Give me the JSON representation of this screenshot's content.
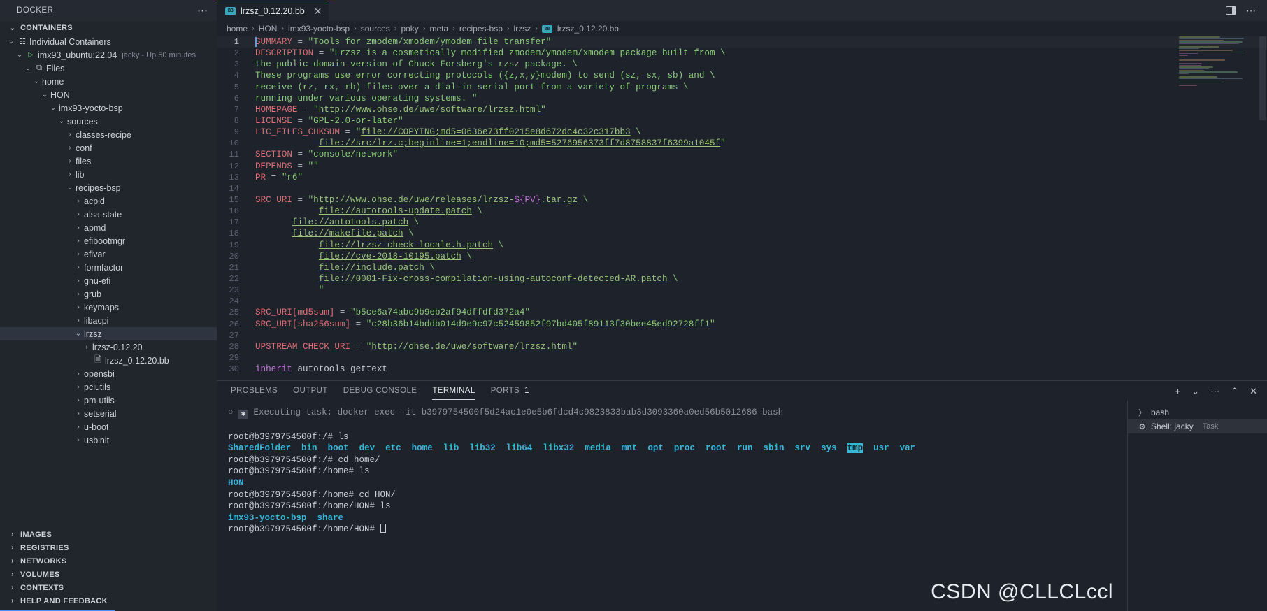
{
  "topbar": {
    "title": "DOCKER",
    "more_label": "⋯",
    "tab": {
      "label": "lrzsz_0.12.20.bb",
      "icon_text": "BB",
      "close": "✕"
    },
    "split_editor": "split-editor",
    "more_actions": "⋯"
  },
  "sidebar": {
    "sections": [
      {
        "label": "CONTAINERS",
        "expanded": true
      },
      {
        "label": "IMAGES",
        "expanded": false
      },
      {
        "label": "REGISTRIES",
        "expanded": false
      },
      {
        "label": "NETWORKS",
        "expanded": false
      },
      {
        "label": "VOLUMES",
        "expanded": false
      },
      {
        "label": "CONTEXTS",
        "expanded": false
      },
      {
        "label": "HELP AND FEEDBACK",
        "expanded": false
      }
    ],
    "tree": [
      {
        "label": "Individual Containers",
        "indent": 1,
        "twisty": "⌄",
        "icon": "containers-icon",
        "sub": ""
      },
      {
        "label": "imx93_ubuntu:22.04",
        "indent": 2,
        "twisty": "⌄",
        "icon": "play-icon",
        "sub": "jacky - Up 50 minutes"
      },
      {
        "label": "Files",
        "indent": 3,
        "twisty": "⌄",
        "icon": "files-icon",
        "sub": ""
      },
      {
        "label": "home",
        "indent": 4,
        "twisty": "⌄",
        "icon": "",
        "sub": ""
      },
      {
        "label": "HON",
        "indent": 5,
        "twisty": "⌄",
        "icon": "",
        "sub": ""
      },
      {
        "label": "imx93-yocto-bsp",
        "indent": 6,
        "twisty": "⌄",
        "icon": "",
        "sub": ""
      },
      {
        "label": "sources",
        "indent": 7,
        "twisty": "⌄",
        "icon": "",
        "sub": ""
      },
      {
        "label": "classes-recipe",
        "indent": 8,
        "twisty": "›",
        "icon": "",
        "sub": ""
      },
      {
        "label": "conf",
        "indent": 8,
        "twisty": "›",
        "icon": "",
        "sub": ""
      },
      {
        "label": "files",
        "indent": 8,
        "twisty": "›",
        "icon": "",
        "sub": ""
      },
      {
        "label": "lib",
        "indent": 8,
        "twisty": "›",
        "icon": "",
        "sub": ""
      },
      {
        "label": "recipes-bsp",
        "indent": 8,
        "twisty": "⌄",
        "icon": "",
        "sub": ""
      },
      {
        "label": "acpid",
        "indent": 9,
        "twisty": "›",
        "icon": "",
        "sub": ""
      },
      {
        "label": "alsa-state",
        "indent": 9,
        "twisty": "›",
        "icon": "",
        "sub": ""
      },
      {
        "label": "apmd",
        "indent": 9,
        "twisty": "›",
        "icon": "",
        "sub": ""
      },
      {
        "label": "efibootmgr",
        "indent": 9,
        "twisty": "›",
        "icon": "",
        "sub": ""
      },
      {
        "label": "efivar",
        "indent": 9,
        "twisty": "›",
        "icon": "",
        "sub": ""
      },
      {
        "label": "formfactor",
        "indent": 9,
        "twisty": "›",
        "icon": "",
        "sub": ""
      },
      {
        "label": "gnu-efi",
        "indent": 9,
        "twisty": "›",
        "icon": "",
        "sub": ""
      },
      {
        "label": "grub",
        "indent": 9,
        "twisty": "›",
        "icon": "",
        "sub": ""
      },
      {
        "label": "keymaps",
        "indent": 9,
        "twisty": "›",
        "icon": "",
        "sub": ""
      },
      {
        "label": "libacpi",
        "indent": 9,
        "twisty": "›",
        "icon": "",
        "sub": ""
      },
      {
        "label": "lrzsz",
        "indent": 9,
        "twisty": "⌄",
        "icon": "",
        "sub": "",
        "selected": true
      },
      {
        "label": "lrzsz-0.12.20",
        "indent": 10,
        "twisty": "›",
        "icon": "",
        "sub": ""
      },
      {
        "label": "lrzsz_0.12.20.bb",
        "indent": 10,
        "twisty": "",
        "icon": "file-icon",
        "sub": ""
      },
      {
        "label": "opensbi",
        "indent": 9,
        "twisty": "›",
        "icon": "",
        "sub": ""
      },
      {
        "label": "pciutils",
        "indent": 9,
        "twisty": "›",
        "icon": "",
        "sub": ""
      },
      {
        "label": "pm-utils",
        "indent": 9,
        "twisty": "›",
        "icon": "",
        "sub": ""
      },
      {
        "label": "setserial",
        "indent": 9,
        "twisty": "›",
        "icon": "",
        "sub": ""
      },
      {
        "label": "u-boot",
        "indent": 9,
        "twisty": "›",
        "icon": "",
        "sub": ""
      },
      {
        "label": "usbinit",
        "indent": 9,
        "twisty": "›",
        "icon": "",
        "sub": ""
      }
    ]
  },
  "breadcrumb": {
    "items": [
      "home",
      "HON",
      "imx93-yocto-bsp",
      "sources",
      "poky",
      "meta",
      "recipes-bsp",
      "lrzsz"
    ],
    "file": "lrzsz_0.12.20.bb",
    "file_icon_text": "BB",
    "separator": "›"
  },
  "editor": {
    "lines": [
      {
        "n": 1,
        "current": true,
        "spans": [
          {
            "t": "SUMMARY",
            "c": "k"
          },
          {
            "t": " = ",
            "c": "op"
          },
          {
            "t": "\"Tools for zmodem/xmodem/ymodem file transfer\"",
            "c": "s"
          }
        ]
      },
      {
        "n": 2,
        "spans": [
          {
            "t": "DESCRIPTION",
            "c": "k"
          },
          {
            "t": " = ",
            "c": "op"
          },
          {
            "t": "\"Lrzsz is a cosmetically modified zmodem/ymodem/xmodem package built from \\",
            "c": "s"
          }
        ]
      },
      {
        "n": 3,
        "spans": [
          {
            "t": "the public-domain version of Chuck Forsberg's rzsz package. \\",
            "c": "s"
          }
        ]
      },
      {
        "n": 4,
        "spans": [
          {
            "t": "These programs use error correcting protocols ({z,x,y}modem) to send (sz, sx, sb) and \\",
            "c": "s"
          }
        ]
      },
      {
        "n": 5,
        "spans": [
          {
            "t": "receive (rz, rx, rb) files over a dial-in serial port from a variety of programs \\",
            "c": "s"
          }
        ]
      },
      {
        "n": 6,
        "spans": [
          {
            "t": "running under various operating systems. \"",
            "c": "s"
          }
        ]
      },
      {
        "n": 7,
        "spans": [
          {
            "t": "HOMEPAGE",
            "c": "k"
          },
          {
            "t": " = ",
            "c": "op"
          },
          {
            "t": "\"",
            "c": "s"
          },
          {
            "t": "http://www.ohse.de/uwe/software/lrzsz.html",
            "c": "u"
          },
          {
            "t": "\"",
            "c": "s"
          }
        ]
      },
      {
        "n": 8,
        "spans": [
          {
            "t": "LICENSE",
            "c": "k"
          },
          {
            "t": " = ",
            "c": "op"
          },
          {
            "t": "\"GPL-2.0-or-later\"",
            "c": "s"
          }
        ]
      },
      {
        "n": 9,
        "spans": [
          {
            "t": "LIC_FILES_CHKSUM",
            "c": "k"
          },
          {
            "t": " = ",
            "c": "op"
          },
          {
            "t": "\"",
            "c": "s"
          },
          {
            "t": "file://COPYING;md5=0636e73ff0215e8d672dc4c32c317bb3",
            "c": "u"
          },
          {
            "t": " \\",
            "c": "s"
          }
        ]
      },
      {
        "n": 10,
        "spans": [
          {
            "t": "            ",
            "c": "pl"
          },
          {
            "t": "file://src/lrz.c;beginline=1;endline=10;md5=5276956373ff7d8758837f6399a1045f",
            "c": "u"
          },
          {
            "t": "\"",
            "c": "s"
          }
        ]
      },
      {
        "n": 11,
        "spans": [
          {
            "t": "SECTION",
            "c": "k"
          },
          {
            "t": " = ",
            "c": "op"
          },
          {
            "t": "\"console/network\"",
            "c": "s"
          }
        ]
      },
      {
        "n": 12,
        "spans": [
          {
            "t": "DEPENDS",
            "c": "k"
          },
          {
            "t": " = ",
            "c": "op"
          },
          {
            "t": "\"\"",
            "c": "s"
          }
        ]
      },
      {
        "n": 13,
        "spans": [
          {
            "t": "PR",
            "c": "k"
          },
          {
            "t": " = ",
            "c": "op"
          },
          {
            "t": "\"r6\"",
            "c": "s"
          }
        ]
      },
      {
        "n": 14,
        "spans": []
      },
      {
        "n": 15,
        "spans": [
          {
            "t": "SRC_URI",
            "c": "k"
          },
          {
            "t": " = ",
            "c": "op"
          },
          {
            "t": "\"",
            "c": "s"
          },
          {
            "t": "http://www.ohse.de/uwe/releases/lrzsz-",
            "c": "u"
          },
          {
            "t": "${PV}",
            "c": "v"
          },
          {
            "t": ".tar.gz",
            "c": "u"
          },
          {
            "t": " \\",
            "c": "s"
          }
        ]
      },
      {
        "n": 16,
        "spans": [
          {
            "t": "            ",
            "c": "pl"
          },
          {
            "t": "file://autotools-update.patch",
            "c": "u"
          },
          {
            "t": " \\",
            "c": "s"
          }
        ]
      },
      {
        "n": 17,
        "spans": [
          {
            "t": "       ",
            "c": "pl"
          },
          {
            "t": "file://autotools.patch",
            "c": "u"
          },
          {
            "t": " \\",
            "c": "s"
          }
        ]
      },
      {
        "n": 18,
        "spans": [
          {
            "t": "       ",
            "c": "pl"
          },
          {
            "t": "file://makefile.patch",
            "c": "u"
          },
          {
            "t": " \\",
            "c": "s"
          }
        ]
      },
      {
        "n": 19,
        "spans": [
          {
            "t": "            ",
            "c": "pl"
          },
          {
            "t": "file://lrzsz-check-locale.h.patch",
            "c": "u"
          },
          {
            "t": " \\",
            "c": "s"
          }
        ]
      },
      {
        "n": 20,
        "spans": [
          {
            "t": "            ",
            "c": "pl"
          },
          {
            "t": "file://cve-2018-10195.patch",
            "c": "u"
          },
          {
            "t": " \\",
            "c": "s"
          }
        ]
      },
      {
        "n": 21,
        "spans": [
          {
            "t": "            ",
            "c": "pl"
          },
          {
            "t": "file://include.patch",
            "c": "u"
          },
          {
            "t": " \\",
            "c": "s"
          }
        ]
      },
      {
        "n": 22,
        "spans": [
          {
            "t": "            ",
            "c": "pl"
          },
          {
            "t": "file://0001-Fix-cross-compilation-using-autoconf-detected-AR.patch",
            "c": "u"
          },
          {
            "t": " \\",
            "c": "s"
          }
        ]
      },
      {
        "n": 23,
        "spans": [
          {
            "t": "            \"",
            "c": "s"
          }
        ]
      },
      {
        "n": 24,
        "spans": []
      },
      {
        "n": 25,
        "spans": [
          {
            "t": "SRC_URI[md5sum]",
            "c": "k"
          },
          {
            "t": " = ",
            "c": "op"
          },
          {
            "t": "\"b5ce6a74abc9b9eb2af94dffdfd372a4\"",
            "c": "s"
          }
        ]
      },
      {
        "n": 26,
        "spans": [
          {
            "t": "SRC_URI[sha256sum]",
            "c": "k"
          },
          {
            "t": " = ",
            "c": "op"
          },
          {
            "t": "\"c28b36b14bddb014d9e9c97c52459852f97bd405f89113f30bee45ed92728ff1\"",
            "c": "s"
          }
        ]
      },
      {
        "n": 27,
        "spans": []
      },
      {
        "n": 28,
        "spans": [
          {
            "t": "UPSTREAM_CHECK_URI",
            "c": "k"
          },
          {
            "t": " = ",
            "c": "op"
          },
          {
            "t": "\"",
            "c": "s"
          },
          {
            "t": "http://ohse.de/uwe/software/lrzsz.html",
            "c": "u"
          },
          {
            "t": "\"",
            "c": "s"
          }
        ]
      },
      {
        "n": 29,
        "spans": []
      },
      {
        "n": 30,
        "spans": [
          {
            "t": "inherit",
            "c": "kw"
          },
          {
            "t": " autotools gettext",
            "c": "pl"
          }
        ]
      }
    ]
  },
  "panel": {
    "tabs": [
      {
        "label": "PROBLEMS",
        "active": false,
        "count": ""
      },
      {
        "label": "OUTPUT",
        "active": false,
        "count": ""
      },
      {
        "label": "DEBUG CONSOLE",
        "active": false,
        "count": ""
      },
      {
        "label": "TERMINAL",
        "active": true,
        "count": ""
      },
      {
        "label": "PORTS",
        "active": false,
        "count": "1"
      }
    ],
    "actions": [
      "+",
      "⌄",
      "⋯",
      "⌃",
      "✕"
    ],
    "terminal": {
      "task_line_prefix": "○",
      "task_badge": "✱",
      "task_text": "Executing task: docker exec -it b3979754500f5d24ac1e0e5b6fdcd4c9823833bab3d3093360a0ed56b5012686 bash",
      "lines": [
        {
          "type": "prompt",
          "text": "root@b3979754500f:/# ls"
        },
        {
          "type": "ls",
          "items": [
            "SharedFolder",
            "bin",
            "boot",
            "dev",
            "etc",
            "home",
            "lib",
            "lib32",
            "lib64",
            "libx32",
            "media",
            "mnt",
            "opt",
            "proc",
            "root",
            "run",
            "sbin",
            "srv",
            "sys",
            "tmp",
            "usr",
            "var"
          ],
          "highlight": "tmp"
        },
        {
          "type": "prompt",
          "text": "root@b3979754500f:/# cd home/"
        },
        {
          "type": "prompt",
          "text": "root@b3979754500f:/home# ls"
        },
        {
          "type": "ls",
          "items": [
            "HON"
          ],
          "highlight": ""
        },
        {
          "type": "prompt",
          "text": "root@b3979754500f:/home# cd HON/"
        },
        {
          "type": "prompt",
          "text": "root@b3979754500f:/home/HON# ls"
        },
        {
          "type": "ls",
          "items": [
            "imx93-yocto-bsp",
            "share"
          ],
          "highlight": ""
        },
        {
          "type": "prompt-cursor",
          "text": "root@b3979754500f:/home/HON# "
        }
      ]
    },
    "terminal_list": [
      {
        "label": "bash",
        "icon": "terminal-icon",
        "task": "",
        "active": false
      },
      {
        "label": "Shell: jacky",
        "icon": "tools-icon",
        "task": "Task",
        "active": true
      }
    ]
  },
  "watermark": "CSDN @CLLCLccl",
  "colors": {
    "accent": "#4b8ef7",
    "string": "#89ca78",
    "variable": "#e06c75",
    "link": "#98c379",
    "terminal_cyan": "#37b6d9"
  }
}
